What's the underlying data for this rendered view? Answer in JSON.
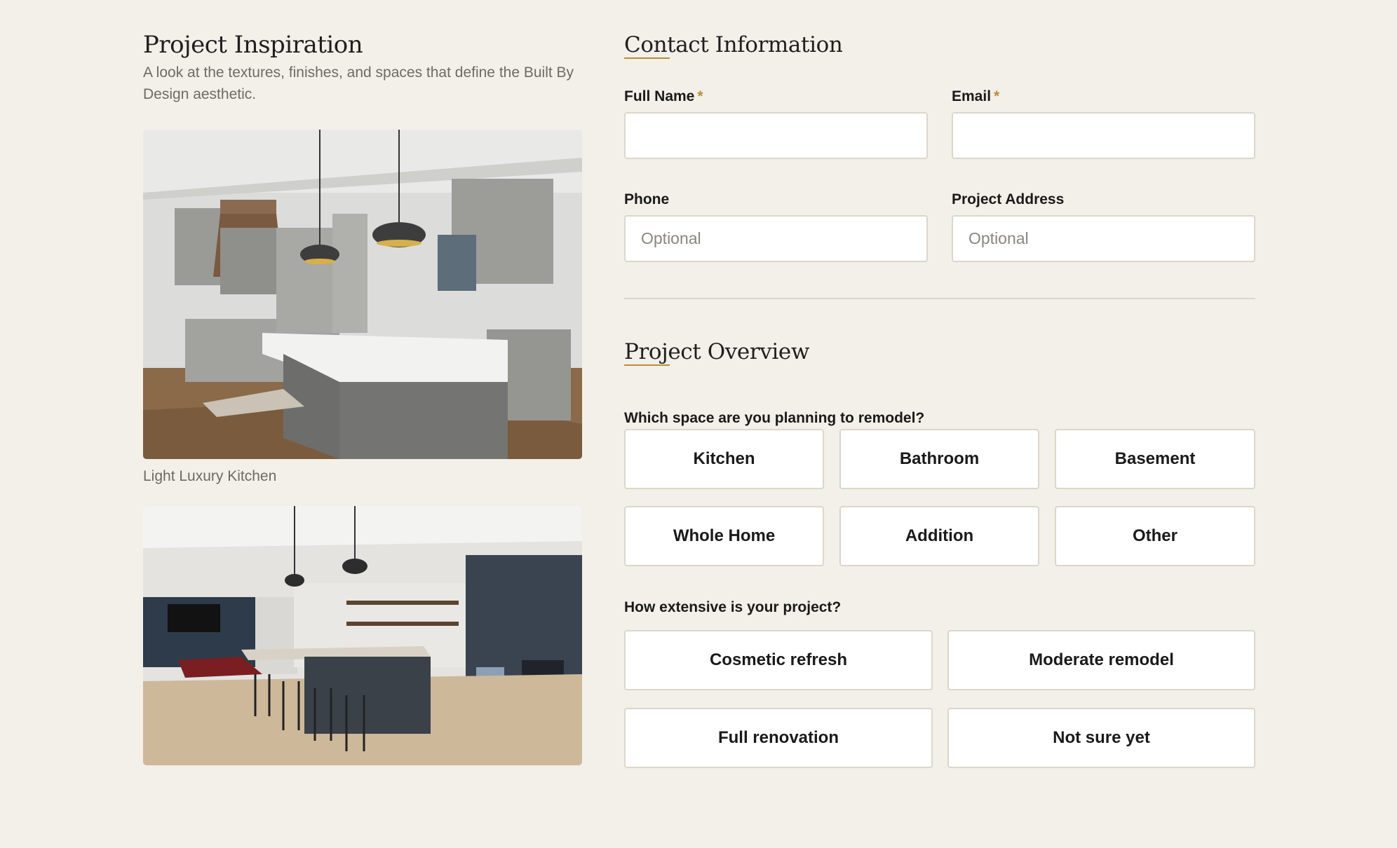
{
  "inspiration": {
    "title": "Project Inspiration",
    "subtitle": "A look at the textures, finishes, and spaces that define the Built By Design aesthetic.",
    "photos": [
      {
        "caption": "Light Luxury Kitchen",
        "alt": "photo of a light luxury kitchen with gray cabinets, white island and pendant lights"
      },
      {
        "caption": "",
        "alt": "photo of a basement bar with dark cabinetry, bar stools and pool table"
      }
    ]
  },
  "contact": {
    "title": "Contact Information",
    "full_name_label": "Full Name",
    "email_label": "Email",
    "required_mark": "*",
    "phone_label": "Phone",
    "phone_placeholder": "Optional",
    "address_label": "Project Address",
    "address_placeholder": "Optional"
  },
  "overview": {
    "title": "Project Overview",
    "space_question": "Which space are you planning to remodel?",
    "space_options": [
      "Kitchen",
      "Bathroom",
      "Basement",
      "Whole Home",
      "Addition",
      "Other"
    ],
    "scope_question": "How extensive is your project?",
    "scope_options": [
      "Cosmetic refresh",
      "Moderate remodel",
      "Full renovation",
      "Not sure yet"
    ]
  },
  "colors": {
    "background": "#f3efe9",
    "accent": "#b8903a",
    "border": "#ddd6cb"
  }
}
